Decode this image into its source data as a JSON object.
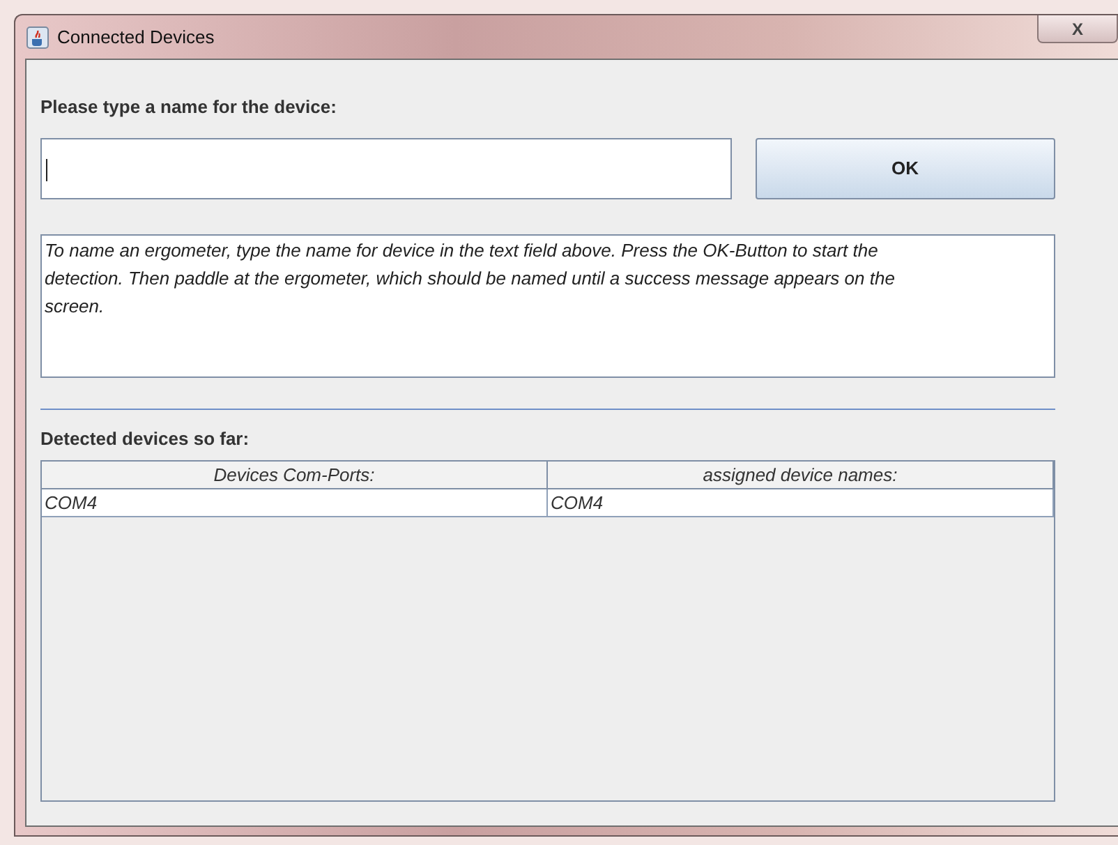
{
  "window": {
    "title": "Connected Devices",
    "close_button": "X"
  },
  "name_prompt": "Please type a name for the device:",
  "name_field": {
    "focused": true
  },
  "ok_button": "OK",
  "instructions": "To name an ergometer, type the name for device in the text field above. Press the OK-Button to start the detection. Then paddle at the ergometer, which should be named until a success message appears on the screen.",
  "detected_label": "Detected devices so far:",
  "table": {
    "columns": [
      "Devices Com-Ports:",
      "assigned device names:"
    ],
    "rows": [
      [
        "COM4",
        "COM4"
      ]
    ]
  }
}
